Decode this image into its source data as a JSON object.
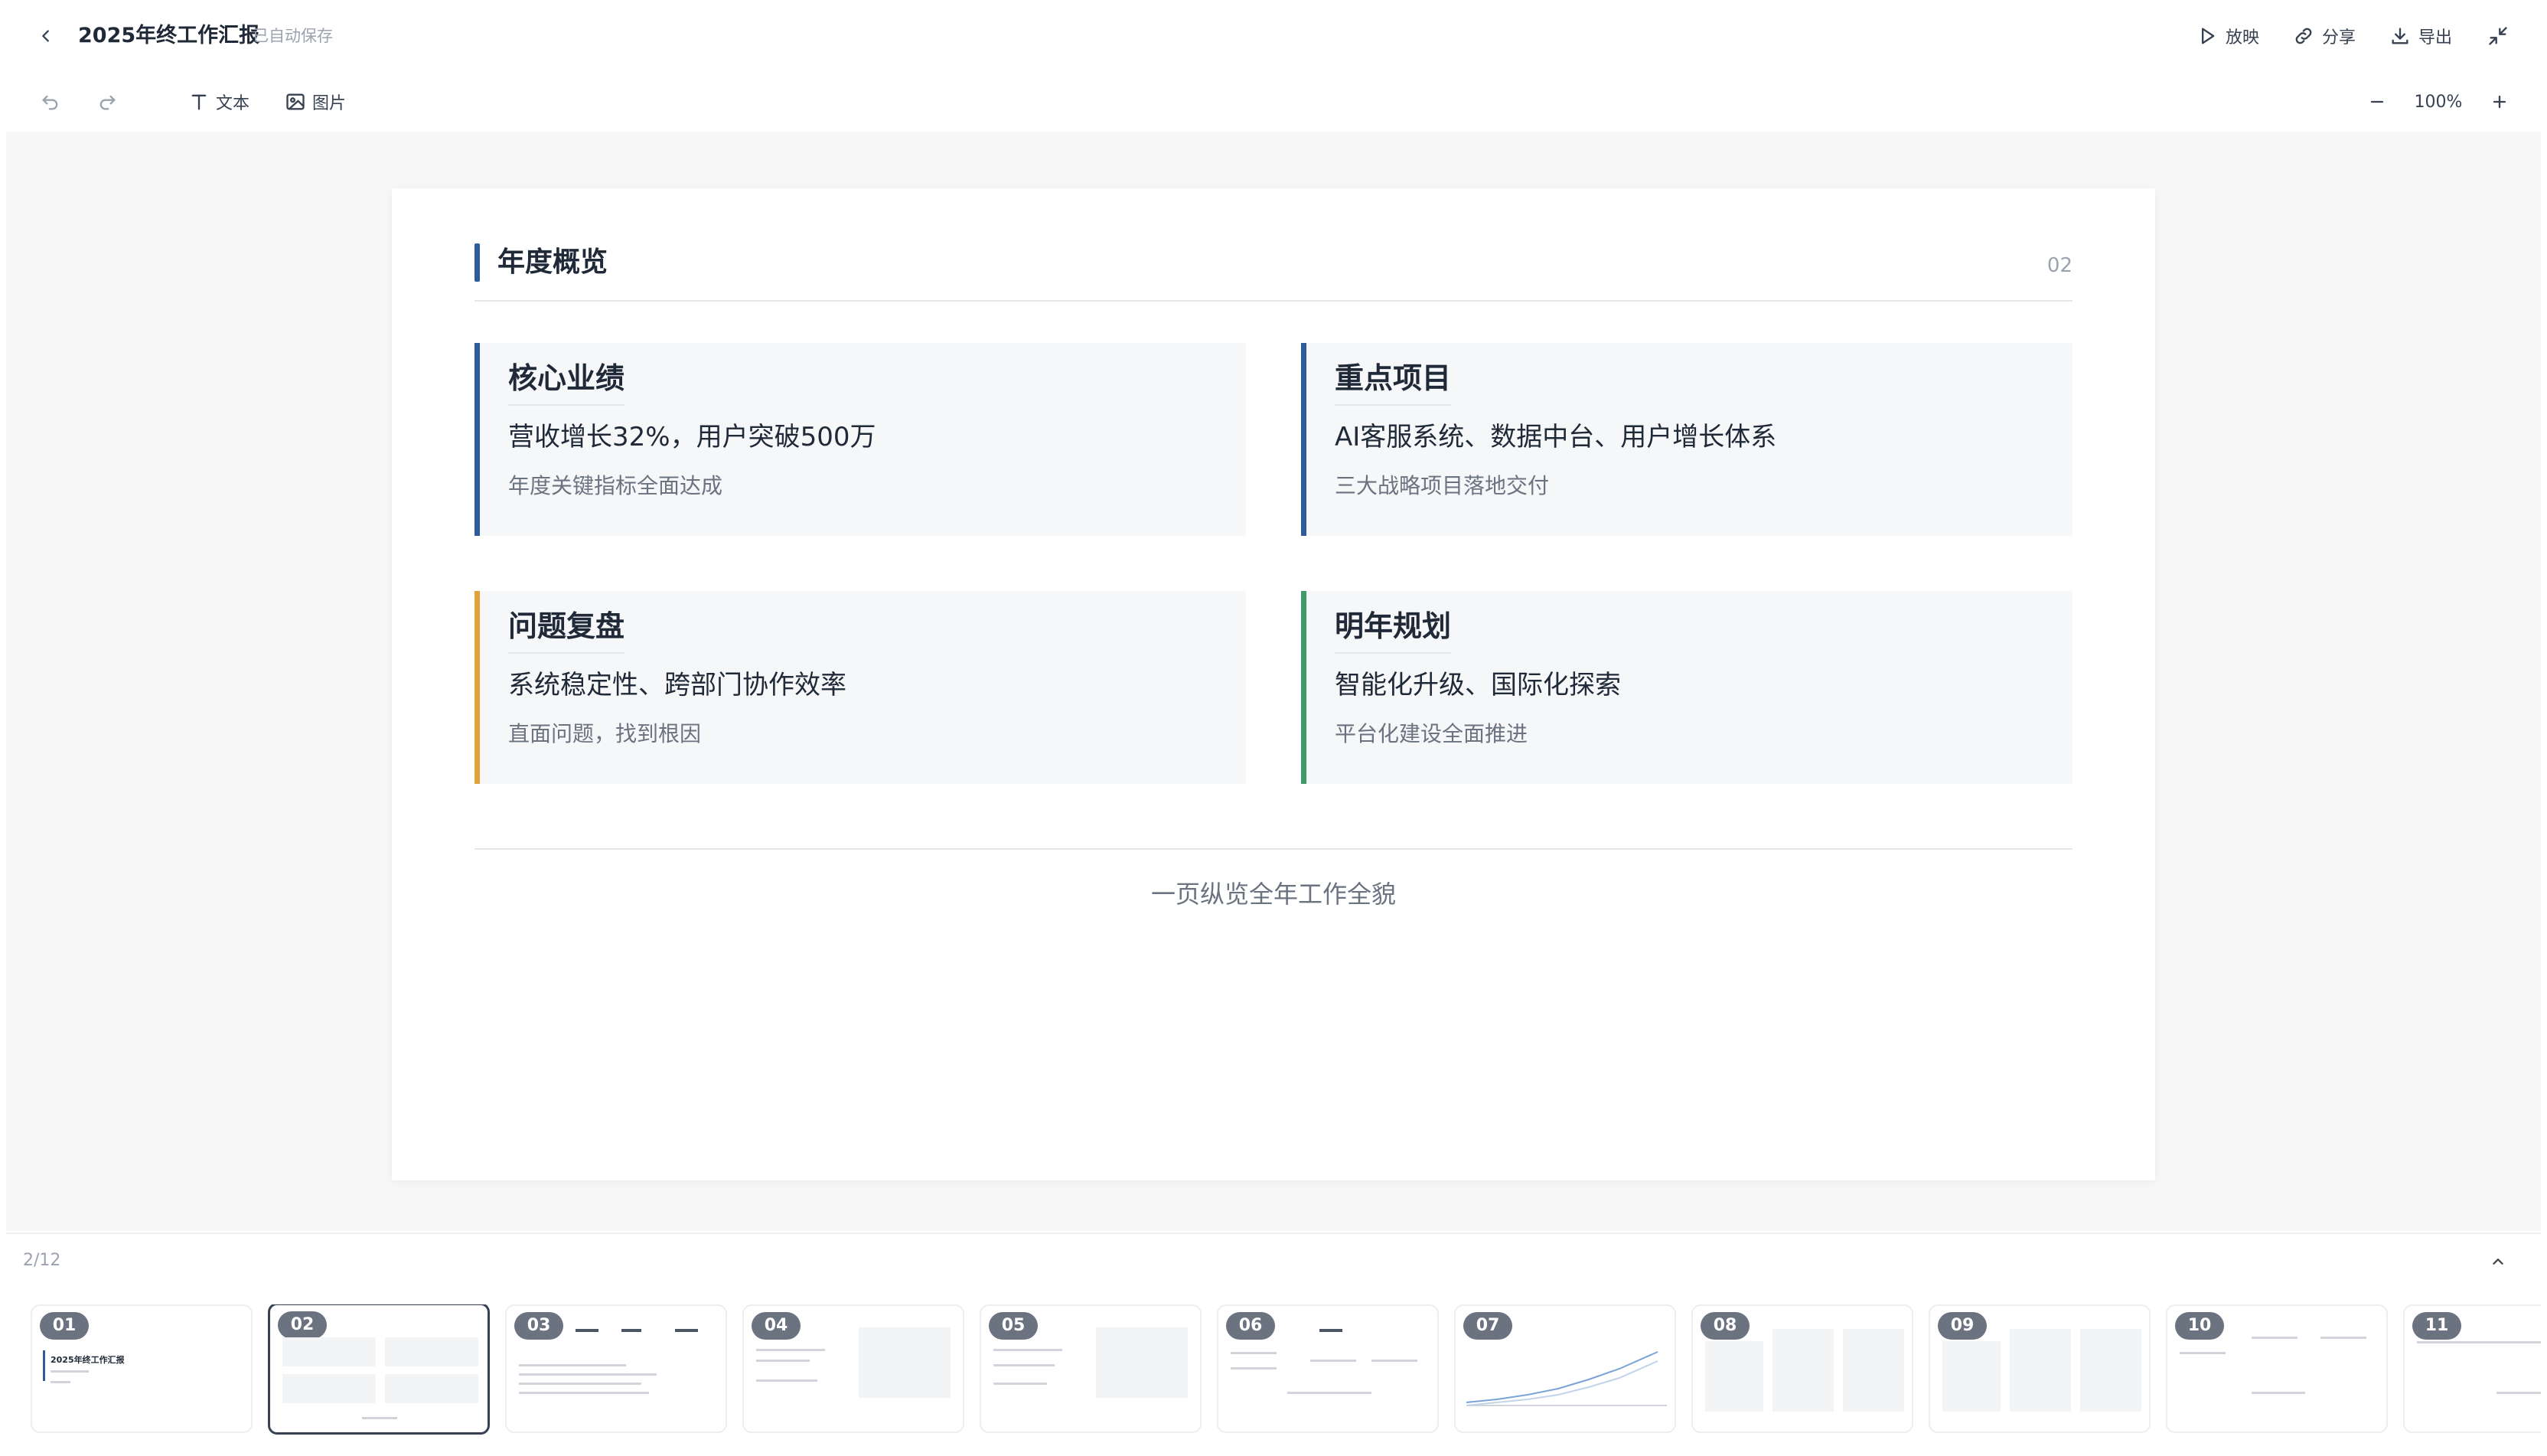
{
  "header": {
    "title": "2025年终工作汇报",
    "autosave": "已自动保存",
    "actions": {
      "present_label": "放映",
      "share_label": "分享",
      "export_label": "导出"
    }
  },
  "toolbar": {
    "text_label": "文本",
    "image_label": "图片",
    "zoom": "100%"
  },
  "slide": {
    "title": "年度概览",
    "number": "02",
    "cards": [
      {
        "title": "核心业绩",
        "main": "营收增长32%，用户突破500万",
        "sub": "年度关键指标全面达成",
        "color": "#2f5b9a"
      },
      {
        "title": "重点项目",
        "main": "AI客服系统、数据中台、用户增长体系",
        "sub": "三大战略项目落地交付",
        "color": "#2f5b9a"
      },
      {
        "title": "问题复盘",
        "main": "系统稳定性、跨部门协作效率",
        "sub": "直面问题，找到根因",
        "color": "#e0a33a"
      },
      {
        "title": "明年规划",
        "main": "智能化升级、国际化探索",
        "sub": "平台化建设全面推进",
        "color": "#3f9b6a"
      }
    ],
    "footer": "一页纵览全年工作全貌"
  },
  "strip": {
    "page_indicator": "2/12",
    "thumbnails": [
      {
        "badge": "01",
        "title": "2025年终工作汇报"
      },
      {
        "badge": "02"
      },
      {
        "badge": "03"
      },
      {
        "badge": "04"
      },
      {
        "badge": "05"
      },
      {
        "badge": "06"
      },
      {
        "badge": "07"
      },
      {
        "badge": "08"
      },
      {
        "badge": "09"
      },
      {
        "badge": "10"
      },
      {
        "badge": "11"
      }
    ]
  }
}
